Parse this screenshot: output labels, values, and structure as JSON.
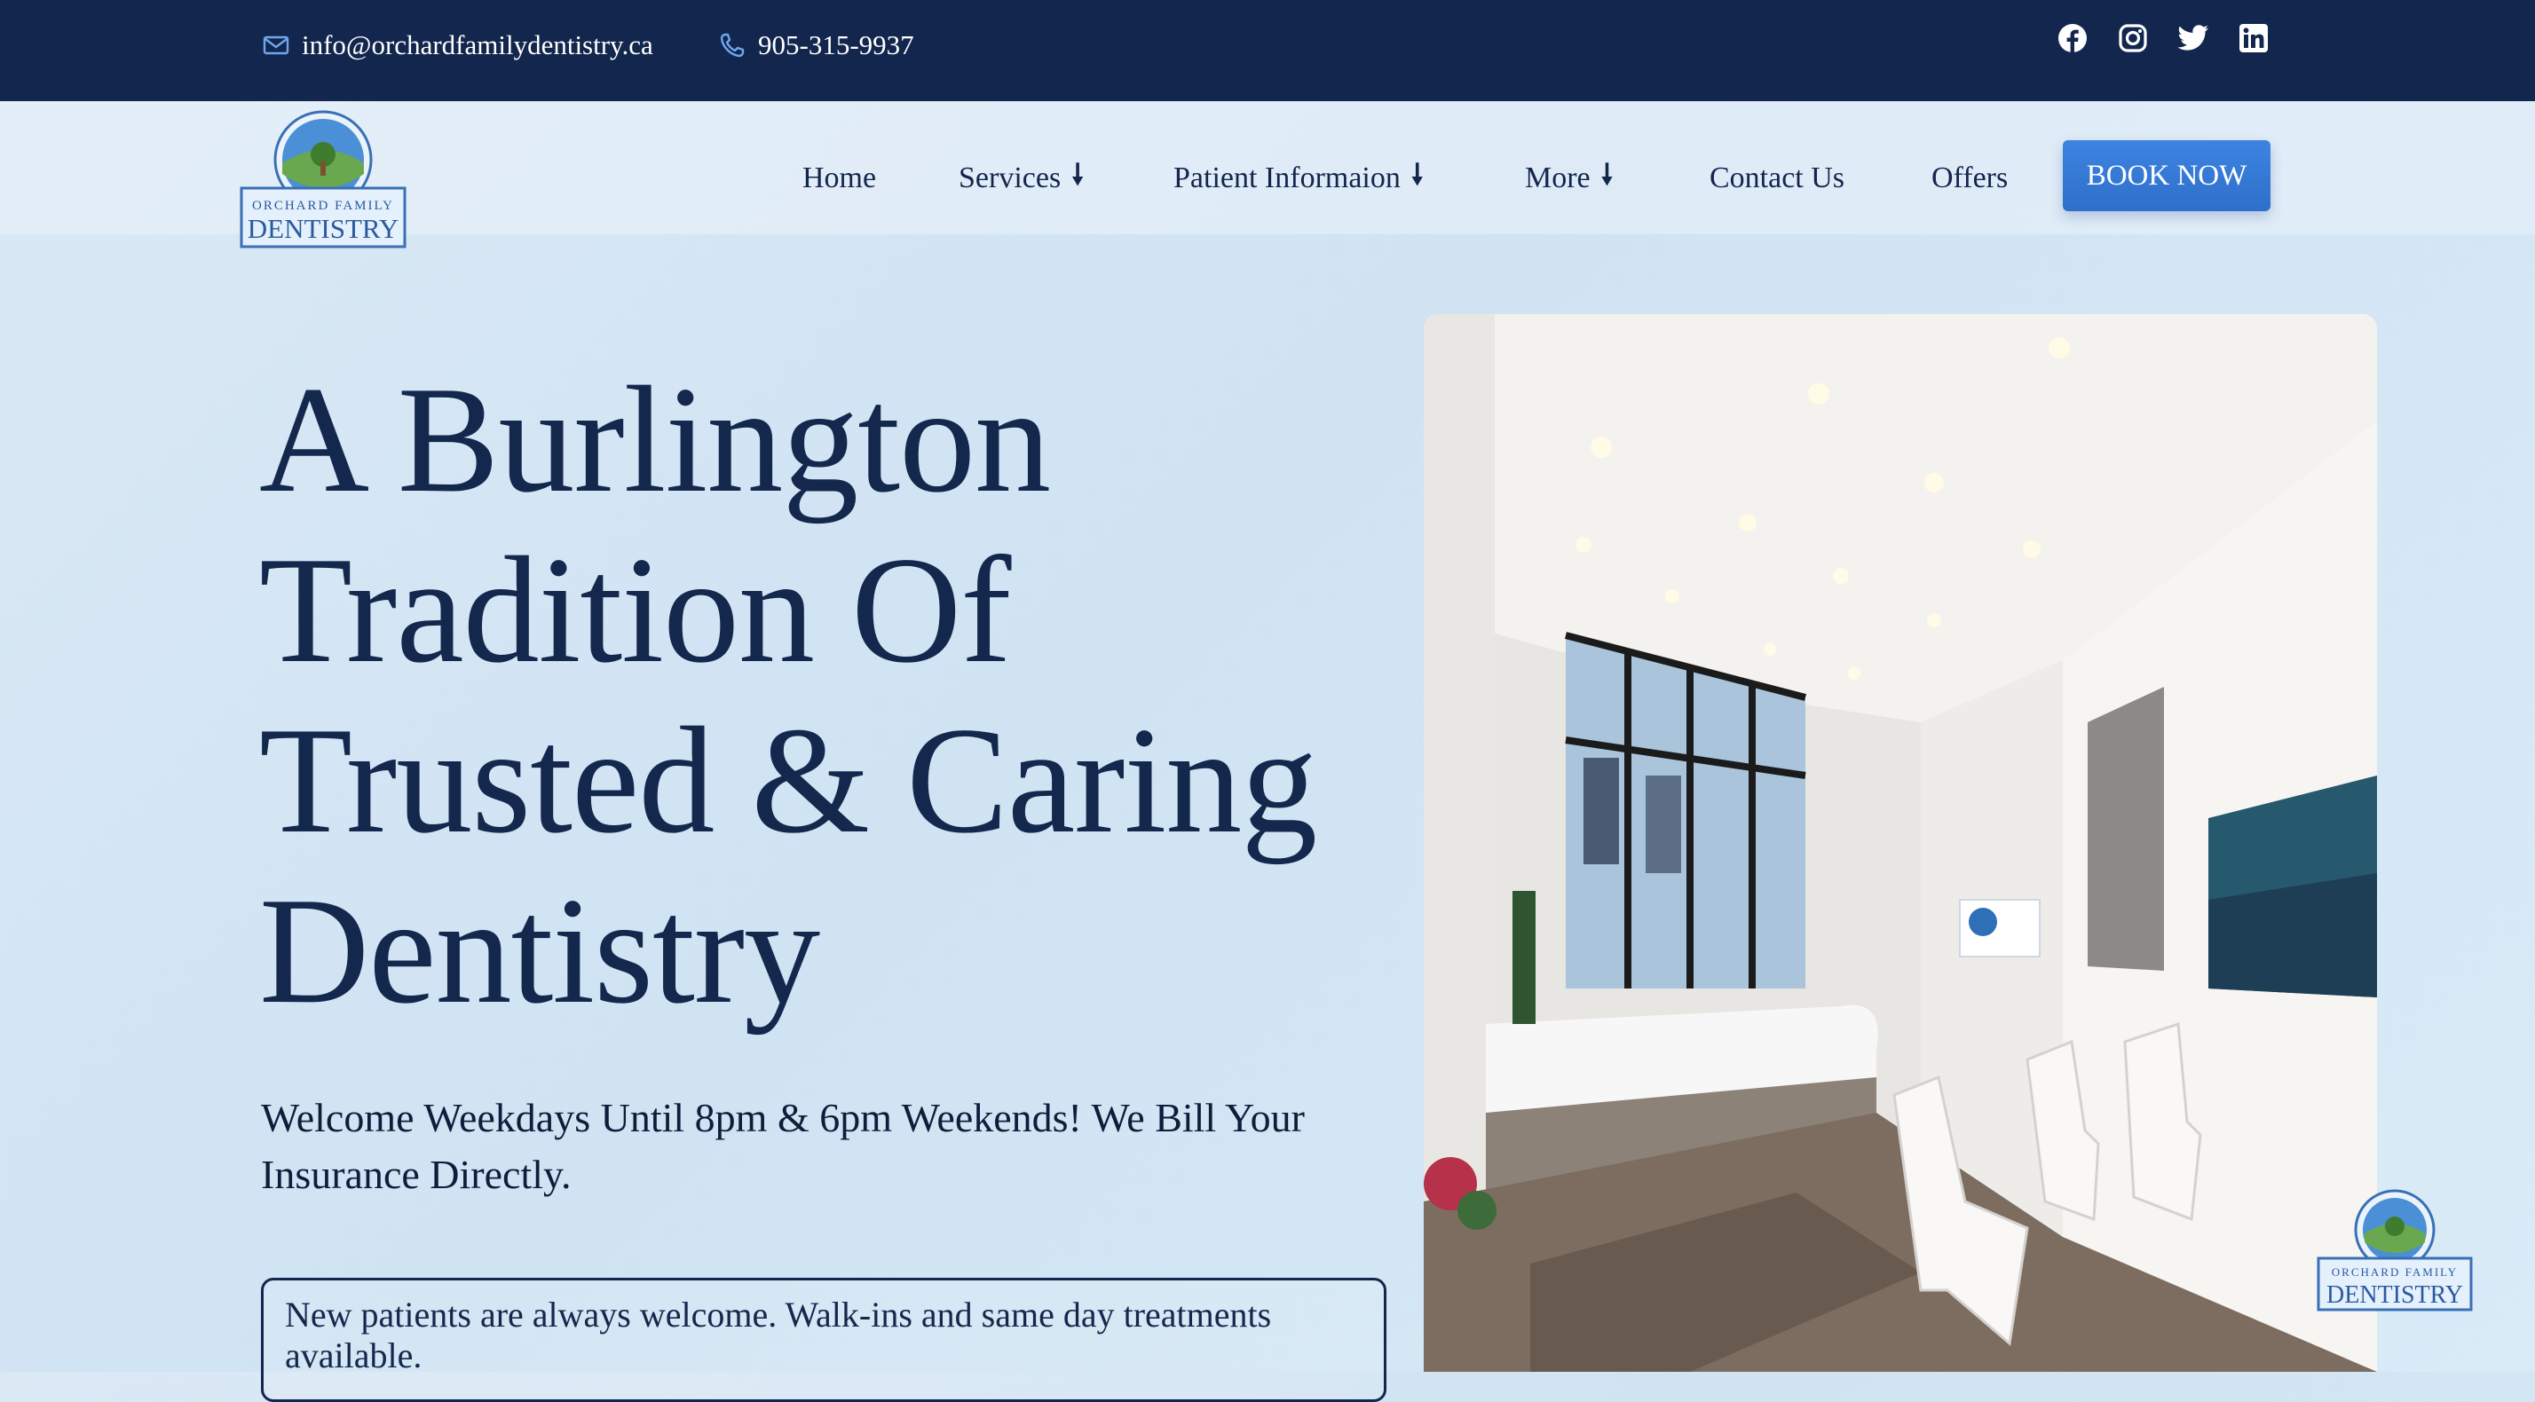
{
  "topbar": {
    "email": "info@orchardfamilydentistry.ca",
    "phone": "905-315-9937",
    "socials": [
      "facebook-icon",
      "instagram-icon",
      "twitter-icon",
      "linkedin-icon"
    ]
  },
  "logo": {
    "line1": "ORCHARD FAMILY",
    "line2": "DENTISTRY"
  },
  "nav": {
    "items": [
      {
        "label": "Home"
      },
      {
        "label": "Services",
        "arrow": "🠗"
      },
      {
        "label": "Patient Informaion",
        "arrow": "🠗"
      },
      {
        "label": "More",
        "arrow": "🠗"
      },
      {
        "label": "Contact Us"
      },
      {
        "label": "Offers"
      }
    ],
    "book_label": "BOOK NOW"
  },
  "hero": {
    "title_lines": [
      "A Burlington",
      "Tradition Of",
      "Trusted & Caring",
      "Dentistry"
    ],
    "subtitle": "Welcome Weekdays Until 8pm & 6pm Weekends! We Bill Your Insurance Directly.",
    "notice": "New patients are always welcome. Walk-ins and same day treatments available."
  },
  "colors": {
    "navy": "#13264d",
    "accent": "#3a7fdc",
    "background": "#d4e6f4"
  }
}
